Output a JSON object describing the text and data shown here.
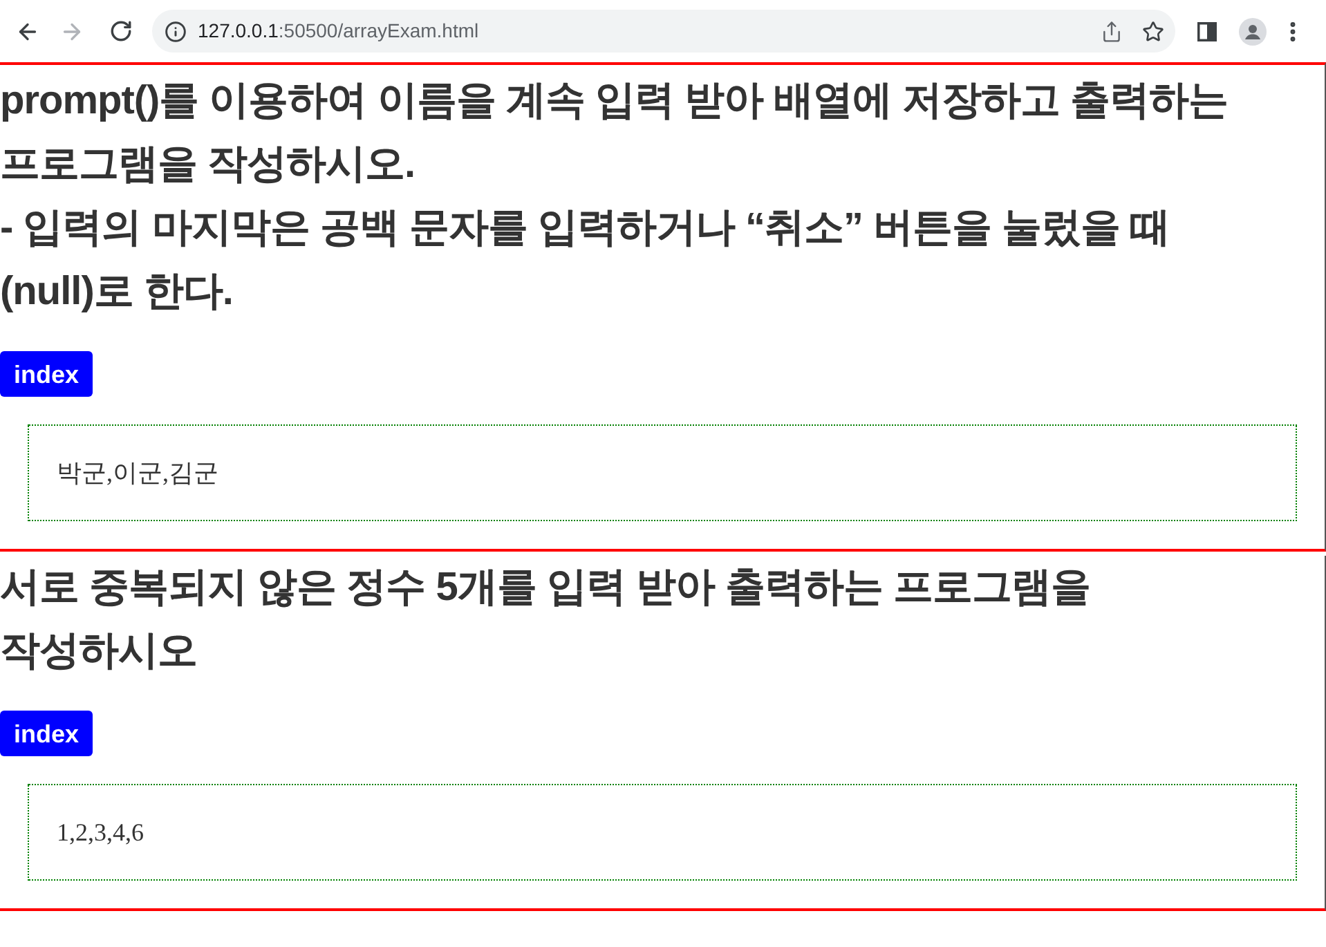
{
  "browser": {
    "nav_buttons": [
      {
        "kind": "back",
        "disabled": false
      },
      {
        "kind": "forward",
        "disabled": true
      },
      {
        "kind": "reload",
        "disabled": false
      }
    ],
    "url_host": "127.0.0.1",
    "url_path": ":50500/arrayExam.html"
  },
  "sections": [
    {
      "heading_lines": [
        "prompt()를 이용하여 이름을 계속 입력 받아 배열에 저장하고 출력하는",
        "프로그램을 작성하시오.",
        "- 입력의 마지막은 공백 문자를 입력하거나 “취소” 버튼을 눌렀을 때",
        "(null)로 한다."
      ],
      "button": "index",
      "output": "박군,이군,김군"
    },
    {
      "heading_lines": [
        "서로 중복되지 않은 정수 5개를 입력 받아 출력하는 프로그램을",
        "작성하시오"
      ],
      "button": "index",
      "output": "1,2,3,4,6"
    }
  ]
}
